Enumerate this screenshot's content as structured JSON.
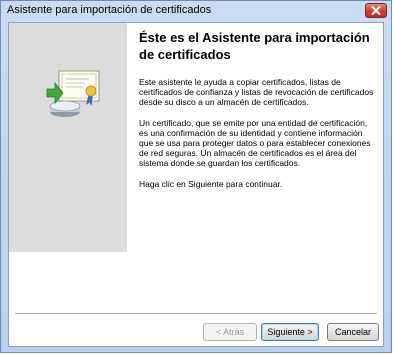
{
  "window": {
    "title": "Asistente para importación de certificados",
    "close_icon": "close-icon"
  },
  "side_panel": {
    "icon": "certificate-import-icon"
  },
  "content": {
    "heading": "Éste es el Asistente para importación de certificados",
    "paragraphs": [
      "Este asistente le ayuda a copiar certificados, listas de certificados de confianza y listas de revocación de certificados desde su disco a un almacén de certificados.",
      "Un certificado, que se emite por una entidad de certificación, es una confirmación de su identidad y contiene información que se usa para proteger datos o para establecer conexiones de red seguras. Un almacén de certificados es el área del sistema donde se guardan los certificados.",
      "Haga clic en Siguiente para continuar."
    ]
  },
  "buttons": {
    "back": "< Atrás",
    "next": "Siguiente >",
    "cancel": "Cancelar"
  },
  "colors": {
    "titlebar": "#c9dcf3",
    "close_button": "#c9442e",
    "side_panel": "#dcdcdc",
    "default_button_border": "#3c7fb1"
  }
}
